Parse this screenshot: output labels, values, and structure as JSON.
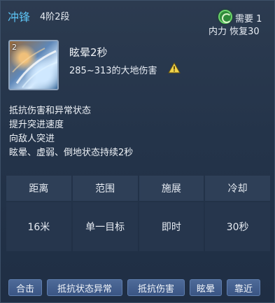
{
  "header": {
    "skill_name": "冲锋",
    "skill_rank": "4阶2段",
    "cost_need": "需要 1",
    "cost_resource": "内力 恢复30"
  },
  "icon": {
    "name": "charge-skill-icon",
    "rank_badge": "2"
  },
  "effect": {
    "title": "眩晕2秒",
    "damage": "285~313的大地伤害",
    "warning_icon": "warning-triangle-icon",
    "warning_color": "#f1d34a"
  },
  "description": [
    "抵抗伤害和异常状态",
    "提升突进速度",
    "向敌人突进",
    "眩晕、虚弱、倒地状态持续2秒"
  ],
  "stats": {
    "headers": [
      "距离",
      "范围",
      "施展",
      "冷却"
    ],
    "values": [
      "16米",
      "单一目标",
      "即时",
      "30秒"
    ]
  },
  "tags": [
    "合击",
    "抵抗状态异常",
    "抵抗伤害",
    "眩晕",
    "靠近"
  ],
  "colors": {
    "name_accent": "#5cc1f2",
    "tag_bg": "#3f5a8a",
    "cost_icon": "#6ad36b"
  }
}
